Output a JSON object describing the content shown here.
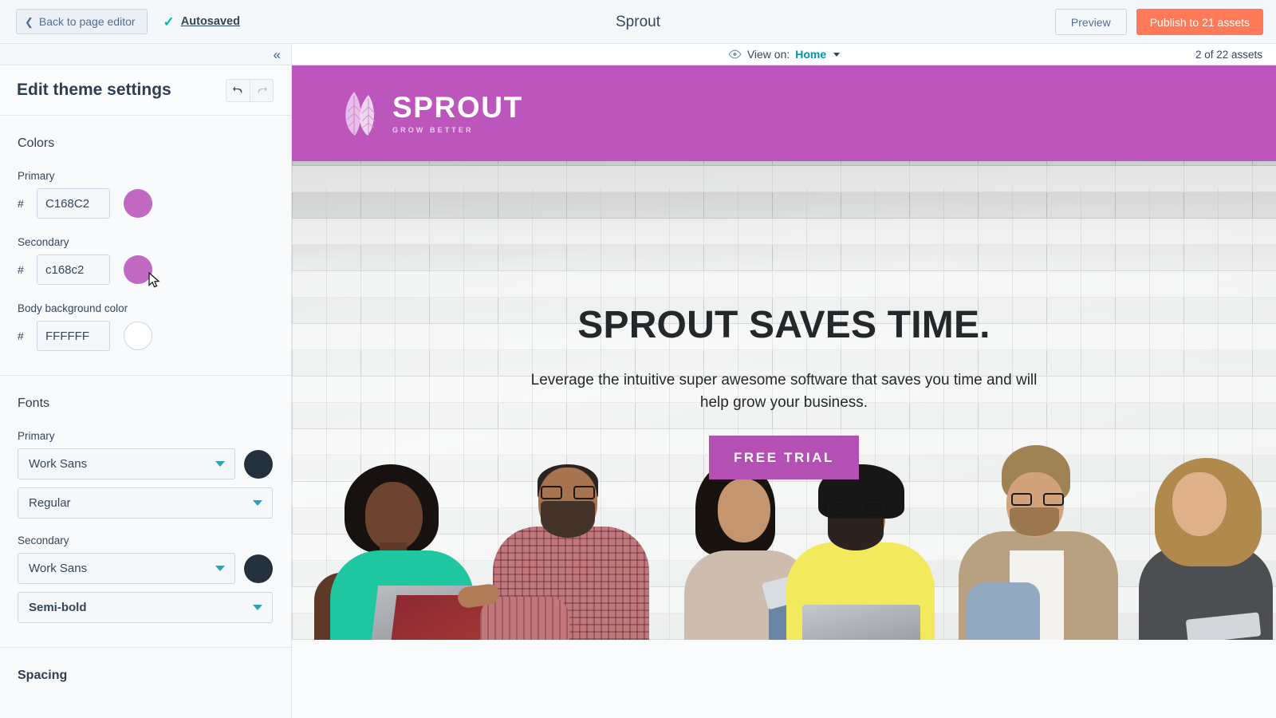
{
  "topbar": {
    "back_label": "Back to page editor",
    "back_icon": "chevron-left-icon",
    "autosaved_label": "Autosaved",
    "autosaved_icon": "check-icon",
    "page_title": "Sprout",
    "preview_label": "Preview",
    "publish_label": "Publish to 21 assets",
    "publish_color": "#ff7a59"
  },
  "sidebar": {
    "collapse_icon": "chevrons-left-icon",
    "title": "Edit theme settings",
    "undo_icon": "undo-icon",
    "redo_icon": "redo-icon",
    "colors": {
      "section_title": "Colors",
      "fields": [
        {
          "label": "Primary",
          "hash": "#",
          "value": "C168C2",
          "swatch": "#C168C2"
        },
        {
          "label": "Secondary",
          "hash": "#",
          "value": "c168c2",
          "swatch": "#C168C2"
        },
        {
          "label": "Body background color",
          "hash": "#",
          "value": "FFFFFF",
          "swatch": "#FFFFFF"
        }
      ]
    },
    "fonts": {
      "section_title": "Fonts",
      "primary_label": "Primary",
      "primary_family": "Work Sans",
      "primary_weight": "Regular",
      "primary_color": "#25303d",
      "secondary_label": "Secondary",
      "secondary_family": "Work Sans",
      "secondary_weight": "Semi-bold",
      "secondary_color": "#25303d",
      "caret_icon": "chevron-down-icon"
    },
    "spacing": {
      "section_title": "Spacing"
    }
  },
  "preview": {
    "view_on_icon": "eye-icon",
    "view_on_label": "View on:",
    "view_on_value": "Home",
    "view_on_caret": "chevron-down-icon",
    "asset_count": "2 of 22 assets"
  },
  "site": {
    "header_bg": "#BC56BC",
    "logo": {
      "icon": "leaf-icon",
      "word": "SPROUT",
      "tagline": "GROW BETTER"
    },
    "hero": {
      "title": "SPROUT SAVES TIME.",
      "subtitle": "Leverage the intuitive super awesome software that saves you time and will help grow your business.",
      "cta_label": "FREE TRIAL",
      "cta_color": "#b44fb4"
    }
  }
}
